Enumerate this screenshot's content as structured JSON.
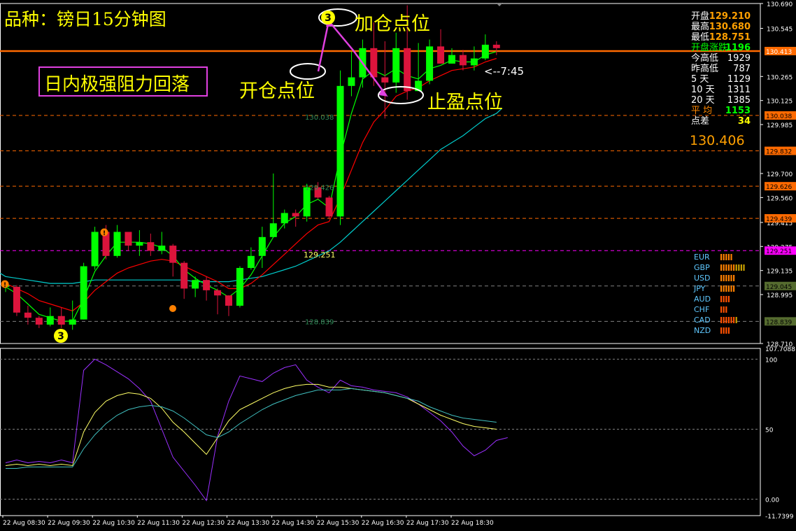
{
  "title": "品种：镑日15分钟图",
  "box_label": "日内极强阻力回落",
  "annotations": {
    "open": "开仓点位",
    "add": "加仓点位",
    "stop": "止盈点位",
    "badge": "3"
  },
  "time_left": "<--7:45",
  "stats": [
    {
      "label": "开盘",
      "value": "129.210"
    },
    {
      "label": "最高",
      "value": "130.680"
    },
    {
      "label": "最低",
      "value": "128.751"
    },
    {
      "label": "开盘涨跌",
      "value": "1196"
    },
    {
      "label": "今高低",
      "value": "1929"
    },
    {
      "label": "昨高低",
      "value": "787"
    },
    {
      "label": "5 天",
      "value": "1129"
    },
    {
      "label": "10 天",
      "value": "1311"
    },
    {
      "label": "20 天",
      "value": "1385"
    },
    {
      "label": "平 均",
      "value": "1153"
    },
    {
      "label": "点差",
      "value": "34"
    }
  ],
  "current_price": "130.406",
  "level_labels": {
    "r1": "130.038",
    "s1": "129.426",
    "pivot": "129.251",
    "s2": "128.839"
  },
  "currency_strength": [
    {
      "name": "EUR",
      "bars": 5,
      "color": "#ff8000"
    },
    {
      "name": "GBP",
      "bars": 10,
      "color": "#ff8000"
    },
    {
      "name": "USD",
      "bars": 6,
      "color": "#ff8000"
    },
    {
      "name": "JPY",
      "bars": 6,
      "color": "#ff8000"
    },
    {
      "name": "AUD",
      "bars": 4,
      "color": "#ff5000"
    },
    {
      "name": "CHF",
      "bars": 3,
      "color": "#ff5000"
    },
    {
      "name": "CAD",
      "bars": 7,
      "color": "#ff5000"
    },
    {
      "name": "NZD",
      "bars": 4,
      "color": "#ff5000"
    }
  ],
  "colors": {
    "bull": "#00ff00",
    "bear": "#dc143c",
    "resistance": "#ff6a00",
    "pivot": "#ff00ff",
    "ma_slow": "#00cccc",
    "ma_fast": "#00ff00",
    "ma_red": "#ff0000"
  },
  "chart_data": [
    {
      "type": "candlestick",
      "title": "",
      "ylim": [
        128.71,
        130.69
      ],
      "y_ticks": [
        "130.690",
        "130.545",
        "130.265",
        "130.125",
        "129.985",
        "129.700",
        "129.560",
        "129.415",
        "129.275",
        "129.135",
        "128.995",
        "128.710"
      ],
      "price_tags": [
        {
          "value": "130.413",
          "color": "#ff6a00"
        },
        {
          "value": "130.038",
          "color": "#ff6a00"
        },
        {
          "value": "129.832",
          "color": "#ff6a00"
        },
        {
          "value": "129.626",
          "color": "#ff6a00"
        },
        {
          "value": "129.439",
          "color": "#ff6a00"
        },
        {
          "value": "129.251",
          "color": "#ff00ff"
        },
        {
          "value": "129.045",
          "color": "#556b2f"
        },
        {
          "value": "128.839",
          "color": "#556b2f"
        }
      ],
      "x_labels": [
        "22 Aug 08:30",
        "22 Aug 09:30",
        "22 Aug 10:30",
        "22 Aug 11:30",
        "22 Aug 12:30",
        "22 Aug 13:30",
        "22 Aug 14:30",
        "22 Aug 15:30",
        "22 Aug 16:30",
        "22 Aug 17:30",
        "22 Aug 18:30"
      ],
      "candles": [
        [
          129.04,
          129.05,
          129.07,
          129.01
        ],
        [
          129.04,
          128.89,
          129.05,
          128.87
        ],
        [
          128.89,
          128.86,
          128.93,
          128.82
        ],
        [
          128.86,
          128.82,
          128.87,
          128.8
        ],
        [
          128.82,
          128.87,
          128.92,
          128.81
        ],
        [
          128.87,
          128.82,
          128.92,
          128.8
        ],
        [
          128.82,
          128.85,
          128.96,
          128.79
        ],
        [
          128.85,
          129.16,
          129.18,
          128.85
        ],
        [
          129.16,
          129.36,
          129.39,
          129.14
        ],
        [
          129.36,
          129.22,
          129.4,
          129.2
        ],
        [
          129.22,
          129.36,
          129.4,
          129.21
        ],
        [
          129.36,
          129.28,
          129.35,
          129.25
        ],
        [
          129.28,
          129.3,
          129.37,
          129.22
        ],
        [
          129.3,
          129.25,
          129.35,
          129.22
        ],
        [
          129.25,
          129.28,
          129.36,
          129.23
        ],
        [
          129.28,
          129.18,
          129.29,
          129.1
        ],
        [
          129.18,
          129.03,
          129.19,
          128.97
        ],
        [
          129.03,
          129.08,
          129.1,
          128.98
        ],
        [
          129.08,
          129.02,
          129.1,
          128.96
        ],
        [
          129.02,
          128.99,
          129.03,
          128.88
        ],
        [
          128.99,
          128.93,
          128.99,
          128.87
        ],
        [
          128.93,
          129.15,
          129.16,
          128.92
        ],
        [
          129.15,
          129.22,
          129.27,
          129.14
        ],
        [
          129.22,
          129.33,
          129.39,
          129.15
        ],
        [
          129.33,
          129.41,
          129.7,
          129.34
        ],
        [
          129.41,
          129.47,
          129.49,
          129.38
        ],
        [
          129.47,
          129.45,
          129.49,
          129.39
        ],
        [
          129.45,
          129.62,
          129.64,
          129.42
        ],
        [
          129.62,
          129.56,
          129.65,
          129.55
        ],
        [
          129.56,
          129.45,
          129.57,
          129.44
        ],
        [
          129.45,
          130.21,
          130.3,
          129.4
        ],
        [
          130.21,
          130.26,
          130.41,
          130.15
        ],
        [
          130.26,
          130.43,
          130.48,
          130.2
        ],
        [
          130.43,
          130.26,
          130.58,
          130.21
        ],
        [
          130.26,
          130.23,
          130.47,
          130.02
        ],
        [
          130.23,
          130.43,
          130.52,
          130.17
        ],
        [
          130.43,
          130.18,
          130.68,
          130.13
        ],
        [
          130.18,
          130.24,
          130.46,
          130.18
        ],
        [
          130.24,
          130.44,
          130.48,
          130.22
        ],
        [
          130.44,
          130.34,
          130.54,
          130.34
        ],
        [
          130.34,
          130.39,
          130.43,
          130.34
        ],
        [
          130.39,
          130.33,
          130.42,
          130.3
        ],
        [
          130.33,
          130.37,
          130.44,
          130.3
        ],
        [
          130.37,
          130.45,
          130.51,
          130.36
        ],
        [
          130.45,
          130.43,
          130.47,
          130.39
        ]
      ],
      "ma_slow": [
        129.1,
        129.09,
        129.08,
        129.07,
        129.06,
        129.06,
        129.06,
        129.07,
        129.08,
        129.08,
        129.08,
        129.08,
        129.08,
        129.08,
        129.08,
        129.08,
        129.08,
        129.07,
        129.07,
        129.07,
        129.07,
        129.08,
        129.09,
        129.1,
        129.12,
        129.14,
        129.16,
        129.19,
        129.22,
        129.25,
        129.3,
        129.36,
        129.42,
        129.48,
        129.54,
        129.6,
        129.66,
        129.72,
        129.78,
        129.84,
        129.88,
        129.92,
        129.97,
        130.02,
        130.05
      ],
      "ma_fast": [
        129.04,
        129.0,
        128.94,
        128.88,
        128.86,
        128.84,
        128.84,
        128.97,
        129.13,
        129.22,
        129.3,
        129.3,
        129.3,
        129.29,
        129.27,
        129.22,
        129.14,
        129.09,
        129.05,
        129.02,
        128.98,
        129.03,
        129.11,
        129.22,
        129.33,
        129.41,
        129.45,
        129.52,
        129.55,
        129.5,
        129.8,
        130.05,
        130.25,
        130.3,
        130.27,
        130.31,
        130.27,
        130.25,
        130.31,
        130.33,
        130.36,
        130.35,
        130.35,
        130.39,
        130.41
      ],
      "ma_red": [
        129.06,
        129.03,
        129.0,
        128.96,
        128.94,
        128.92,
        128.9,
        128.95,
        129.02,
        129.07,
        129.12,
        129.15,
        129.17,
        129.19,
        129.2,
        129.19,
        129.16,
        129.13,
        129.1,
        129.07,
        129.03,
        129.03,
        129.06,
        129.11,
        129.17,
        129.23,
        129.29,
        129.35,
        129.4,
        129.42,
        129.56,
        129.72,
        129.88,
        130.0,
        130.07,
        130.15,
        130.18,
        130.2,
        130.24,
        130.27,
        130.3,
        130.31,
        130.32,
        130.35,
        130.37
      ]
    },
    {
      "type": "line",
      "title": "",
      "ylim": [
        -11.7399,
        107.7088
      ],
      "y_ticks": [
        "107.7088",
        "100",
        "50",
        "0.00",
        "-11.7399"
      ],
      "series": [
        {
          "values": [
            26,
            28,
            26,
            27,
            26,
            28,
            26,
            92,
            100,
            96,
            91,
            86,
            79,
            70,
            50,
            30,
            20,
            10,
            -1,
            45,
            70,
            88,
            86,
            84,
            90,
            94,
            96,
            85,
            80,
            76,
            85,
            81,
            80,
            78,
            77,
            76,
            73,
            68,
            62,
            56,
            48,
            38,
            31,
            35,
            42,
            44
          ]
        },
        {
          "values": [
            24,
            25,
            24,
            25,
            24,
            25,
            24,
            48,
            62,
            70,
            74,
            76,
            75,
            72,
            65,
            55,
            48,
            40,
            32,
            44,
            56,
            64,
            68,
            72,
            76,
            79,
            81,
            82,
            82,
            80,
            80,
            79,
            78,
            77,
            76,
            74,
            72,
            68,
            64,
            60,
            57,
            54,
            52,
            51,
            50
          ]
        },
        {
          "values": [
            22,
            22,
            23,
            23,
            23,
            23,
            23,
            36,
            46,
            54,
            60,
            64,
            66,
            67,
            66,
            63,
            58,
            52,
            46,
            44,
            48,
            54,
            59,
            64,
            68,
            71,
            74,
            76,
            78,
            78,
            78,
            79,
            78,
            77,
            76,
            74,
            72,
            70,
            66,
            63,
            60,
            58,
            57,
            56,
            55
          ]
        }
      ]
    }
  ]
}
